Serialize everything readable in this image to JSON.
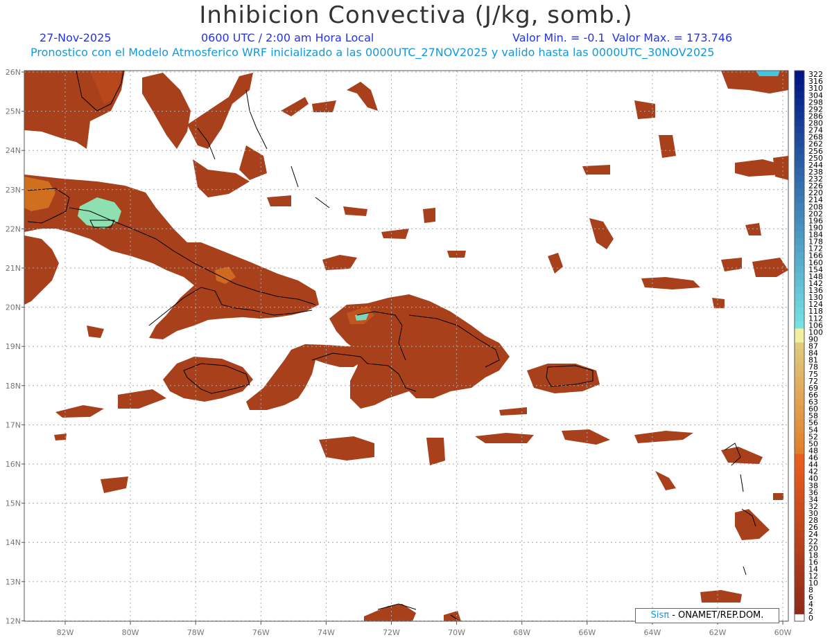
{
  "header": {
    "title": "Inhibicion Convectiva (J/kg, somb.)",
    "date": "27-Nov-2025",
    "time": "0600 UTC / 2:00 am Hora Local",
    "min_max": "Valor Min. = -0.1  Valor Max. = 173.746",
    "forecast_info": "Pronostico con el Modelo Atmosferico WRF inicializado a las 0000UTC_27NOV2025 y valido hasta las  0000UTC_30NOV2025"
  },
  "map": {
    "lon_labels": [
      "82W",
      "80W",
      "78W",
      "76W",
      "74W",
      "72W",
      "70W",
      "68W",
      "66W",
      "64W",
      "62W",
      "60W"
    ],
    "lat_labels": [
      "26N",
      "25N",
      "24N",
      "23N",
      "22N",
      "21N",
      "20N",
      "19N",
      "18N",
      "17N",
      "16N",
      "15N",
      "14N",
      "13N",
      "12N"
    ]
  },
  "colorbar": {
    "labels": [
      "322",
      "316",
      "310",
      "304",
      "298",
      "292",
      "286",
      "280",
      "274",
      "268",
      "262",
      "256",
      "250",
      "244",
      "238",
      "232",
      "226",
      "220",
      "214",
      "208",
      "202",
      "196",
      "190",
      "184",
      "178",
      "172",
      "166",
      "160",
      "154",
      "148",
      "142",
      "136",
      "130",
      "124",
      "118",
      "112",
      "106",
      "100",
      "90",
      "87",
      "84",
      "81",
      "78",
      "75",
      "72",
      "69",
      "66",
      "63",
      "60",
      "58",
      "56",
      "54",
      "52",
      "50",
      "48",
      "46",
      "44",
      "42",
      "40",
      "38",
      "36",
      "34",
      "32",
      "30",
      "28",
      "26",
      "24",
      "22",
      "20",
      "18",
      "16",
      "14",
      "12",
      "10",
      "8",
      "6",
      "4",
      "2",
      "0"
    ]
  },
  "credit": {
    "brand": "Sisπ",
    "text": " - ONAMET/REP.DOM."
  },
  "colors": {
    "field": "#a8401c",
    "land_line": "#000000",
    "grid": "#aaaaaa",
    "title": "#333333",
    "subtitle": "#2233ee",
    "forecast": "#1199dd"
  }
}
